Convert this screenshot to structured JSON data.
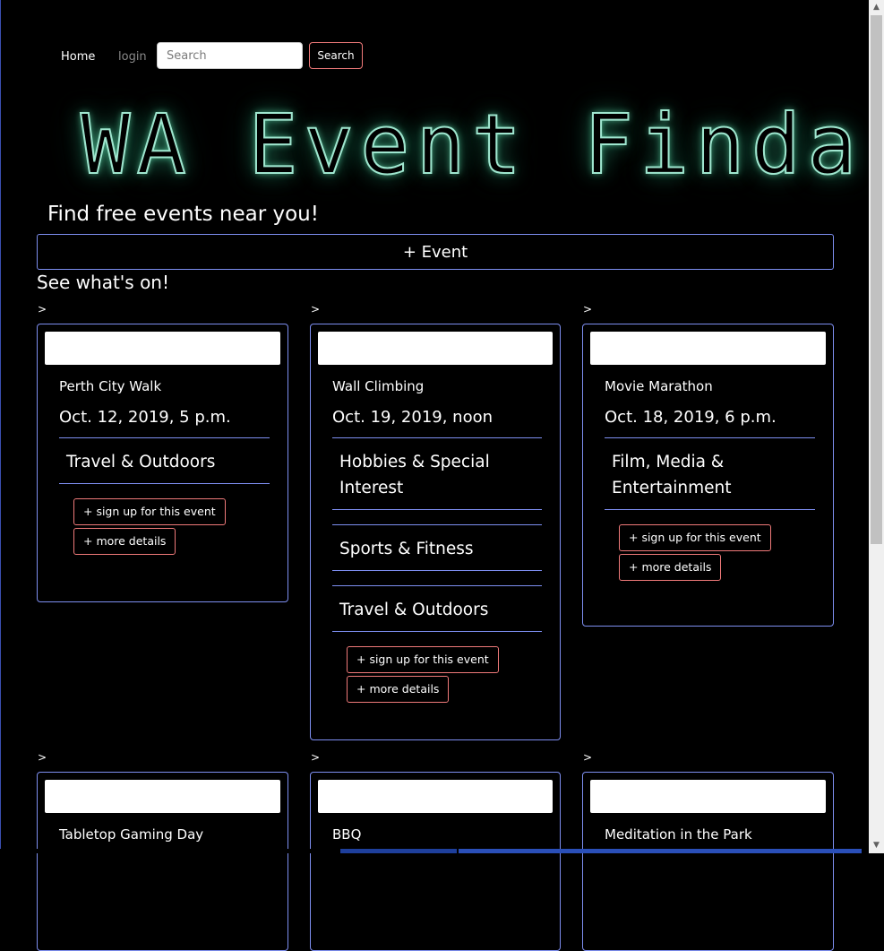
{
  "nav": {
    "home_label": "Home",
    "login_label": "login",
    "search_placeholder": "Search",
    "search_button_label": "Search"
  },
  "header": {
    "logo_text": "WA Event Finda",
    "tagline": "Find free events near you!"
  },
  "add_event_label": "+ Event",
  "section_title": "See what's on!",
  "card_marker": ">",
  "card_buttons": {
    "signup_label": "+ sign up for this event",
    "details_label": "+ more details"
  },
  "events": [
    {
      "title": "Perth City Walk",
      "date": "Oct. 12, 2019, 5 p.m.",
      "categories": [
        "Travel & Outdoors"
      ]
    },
    {
      "title": "Wall Climbing",
      "date": "Oct. 19, 2019, noon",
      "categories": [
        "Hobbies & Special Interest",
        "Sports & Fitness",
        "Travel & Outdoors"
      ]
    },
    {
      "title": "Movie Marathon",
      "date": "Oct. 18, 2019, 6 p.m.",
      "categories": [
        "Film, Media & Entertainment"
      ]
    },
    {
      "title": "Tabletop Gaming Day",
      "date": "",
      "categories": []
    },
    {
      "title": "BBQ",
      "date": "",
      "categories": []
    },
    {
      "title": "Meditation in the Park",
      "date": "",
      "categories": []
    }
  ],
  "colors": {
    "background": "#000000",
    "card_border": "#7d8ef0",
    "button_border": "#f07a7a",
    "logo_neon": "#9fe6cf"
  }
}
